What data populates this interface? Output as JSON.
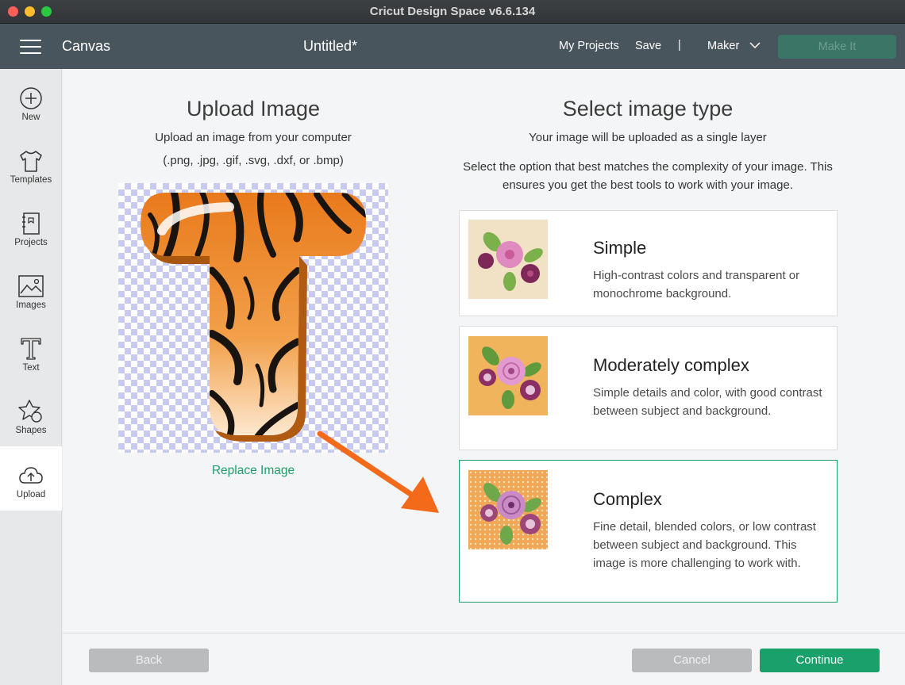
{
  "window": {
    "title": "Cricut Design Space  v6.6.134"
  },
  "header": {
    "canvas_label": "Canvas",
    "document_title": "Untitled*",
    "my_projects": "My Projects",
    "save": "Save",
    "separator": "|",
    "machine": "Maker",
    "make_it": "Make It"
  },
  "sidebar": {
    "items": [
      {
        "label": "New",
        "icon": "plus-circle-icon"
      },
      {
        "label": "Templates",
        "icon": "tshirt-icon"
      },
      {
        "label": "Projects",
        "icon": "notebook-icon"
      },
      {
        "label": "Images",
        "icon": "image-icon"
      },
      {
        "label": "Text",
        "icon": "text-icon"
      },
      {
        "label": "Shapes",
        "icon": "shapes-icon"
      },
      {
        "label": "Upload",
        "icon": "cloud-upload-icon",
        "active": true
      }
    ]
  },
  "upload": {
    "title": "Upload Image",
    "subtitle": "Upload an image from your computer",
    "formats": "(.png, .jpg, .gif, .svg, .dxf, or .bmp)",
    "replace_link": "Replace Image"
  },
  "image_type": {
    "title": "Select image type",
    "subtitle": "Your image will be uploaded as a single layer",
    "instructions": "Select the option that best matches the complexity of your image. This ensures you get the best tools to work with your image.",
    "options": [
      {
        "title": "Simple",
        "description": "High-contrast colors and transparent or monochrome background.",
        "selected": false
      },
      {
        "title": "Moderately complex",
        "description": "Simple details and color, with good contrast between subject and background.",
        "selected": false
      },
      {
        "title": "Complex",
        "description": "Fine detail, blended colors, or low contrast between subject and background. This image is more challenging to work with.",
        "selected": true
      }
    ]
  },
  "footer": {
    "back": "Back",
    "cancel": "Cancel",
    "continue": "Continue"
  },
  "colors": {
    "accent": "#1aa06b",
    "header_bg": "#49555d",
    "annotation_arrow": "#f46a1b"
  }
}
